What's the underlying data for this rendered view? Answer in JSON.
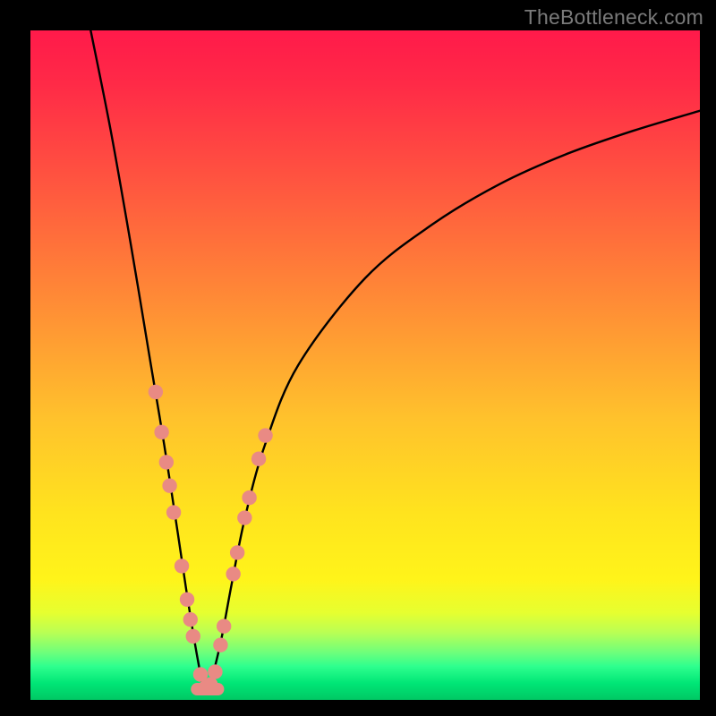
{
  "watermark": "TheBottleneck.com",
  "chart_data": {
    "type": "line",
    "title": "",
    "xlabel": "",
    "ylabel": "",
    "xlim": [
      0,
      100
    ],
    "ylim": [
      0,
      100
    ],
    "note": "Axes are unlabeled; values are estimated pixel-normalized positions (0–100). The curve is a V-shaped bottleneck plot with minimum near x≈26.",
    "series": [
      {
        "name": "bottleneck-curve",
        "x": [
          9,
          12,
          15,
          18,
          20,
          22,
          23.5,
          25,
          26,
          27,
          28.5,
          30,
          32,
          35,
          40,
          50,
          60,
          70,
          80,
          90,
          100
        ],
        "y": [
          100,
          85,
          68,
          50,
          38,
          25,
          15,
          6,
          1.5,
          3,
          9,
          17,
          27,
          38,
          50,
          63,
          71,
          77,
          81.5,
          85,
          88
        ]
      }
    ],
    "markers": {
      "name": "highlighted-points",
      "color": "#e98a84",
      "points_xy": [
        [
          18.7,
          46
        ],
        [
          19.6,
          40
        ],
        [
          20.3,
          35.5
        ],
        [
          20.8,
          32
        ],
        [
          21.4,
          28
        ],
        [
          22.6,
          20
        ],
        [
          23.4,
          15
        ],
        [
          23.9,
          12
        ],
        [
          24.3,
          9.5
        ],
        [
          25.4,
          3.8
        ],
        [
          26.1,
          1.8
        ],
        [
          26.9,
          2.3
        ],
        [
          27.6,
          4.2
        ],
        [
          28.4,
          8.2
        ],
        [
          28.9,
          11
        ],
        [
          30.3,
          18.8
        ],
        [
          30.9,
          22
        ],
        [
          32.0,
          27.2
        ],
        [
          32.7,
          30.2
        ],
        [
          34.1,
          36
        ],
        [
          35.1,
          39.5
        ]
      ]
    },
    "flat_segment": {
      "name": "bottom-flat-marker",
      "color": "#e98a84",
      "x_range": [
        24.9,
        28.0
      ],
      "y": 1.6
    }
  }
}
